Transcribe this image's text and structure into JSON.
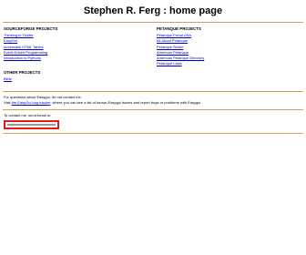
{
  "header": {
    "title": "Stephen R. Ferg : home page"
  },
  "sourceforge": {
    "heading": "SOURCEFORGE PROJECTS",
    "links": [
      "Thinking in Tkinter",
      "EasyGui",
      "Accessible HTML Tables",
      "Event-Driven Programming",
      "Introduction to Pythons"
    ]
  },
  "petanque": {
    "heading": "PETANQUE PROJECTS",
    "links": [
      "Petanque Portal USA",
      "All About Petanque",
      "Petanque Boldin",
      "American Petanque",
      "American Petanque Directory",
      "Petanque Laws"
    ]
  },
  "other": {
    "heading": "OTHER PROJECTS",
    "links": [
      "Bible"
    ]
  },
  "footer": {
    "line1": "For questions about Easygui, do not contact me.",
    "line2_prefix": "Visit",
    "line2_link": "the EasyGui bug tracker",
    "line2_suffix": "where you can see a list of known Easygui issues and report bugs or problems with Easygui.",
    "contact_label": "To contact me, send email to:",
    "email": "steve.ferg.2000@gmail.com"
  }
}
